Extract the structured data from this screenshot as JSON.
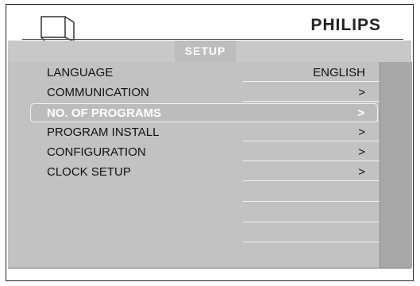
{
  "header": {
    "brand": "PHILIPS",
    "menu_title": "SETUP"
  },
  "menu": {
    "items": [
      {
        "label": "LANGUAGE",
        "value": "ENGLISH"
      },
      {
        "label": "COMMUNICATION",
        "value": ">"
      },
      {
        "label": "NO. OF PROGRAMS",
        "value": ">",
        "selected": true
      },
      {
        "label": "PROGRAM INSTALL",
        "value": ">"
      },
      {
        "label": "CONFIGURATION",
        "value": ">"
      },
      {
        "label": "CLOCK SETUP",
        "value": ">"
      }
    ]
  },
  "colors": {
    "panel": "#c2c2c2",
    "side_panel": "#a8a8a8",
    "highlight_text": "#ffffff",
    "text": "#111111"
  },
  "icons": {
    "header": "tv-icon"
  }
}
